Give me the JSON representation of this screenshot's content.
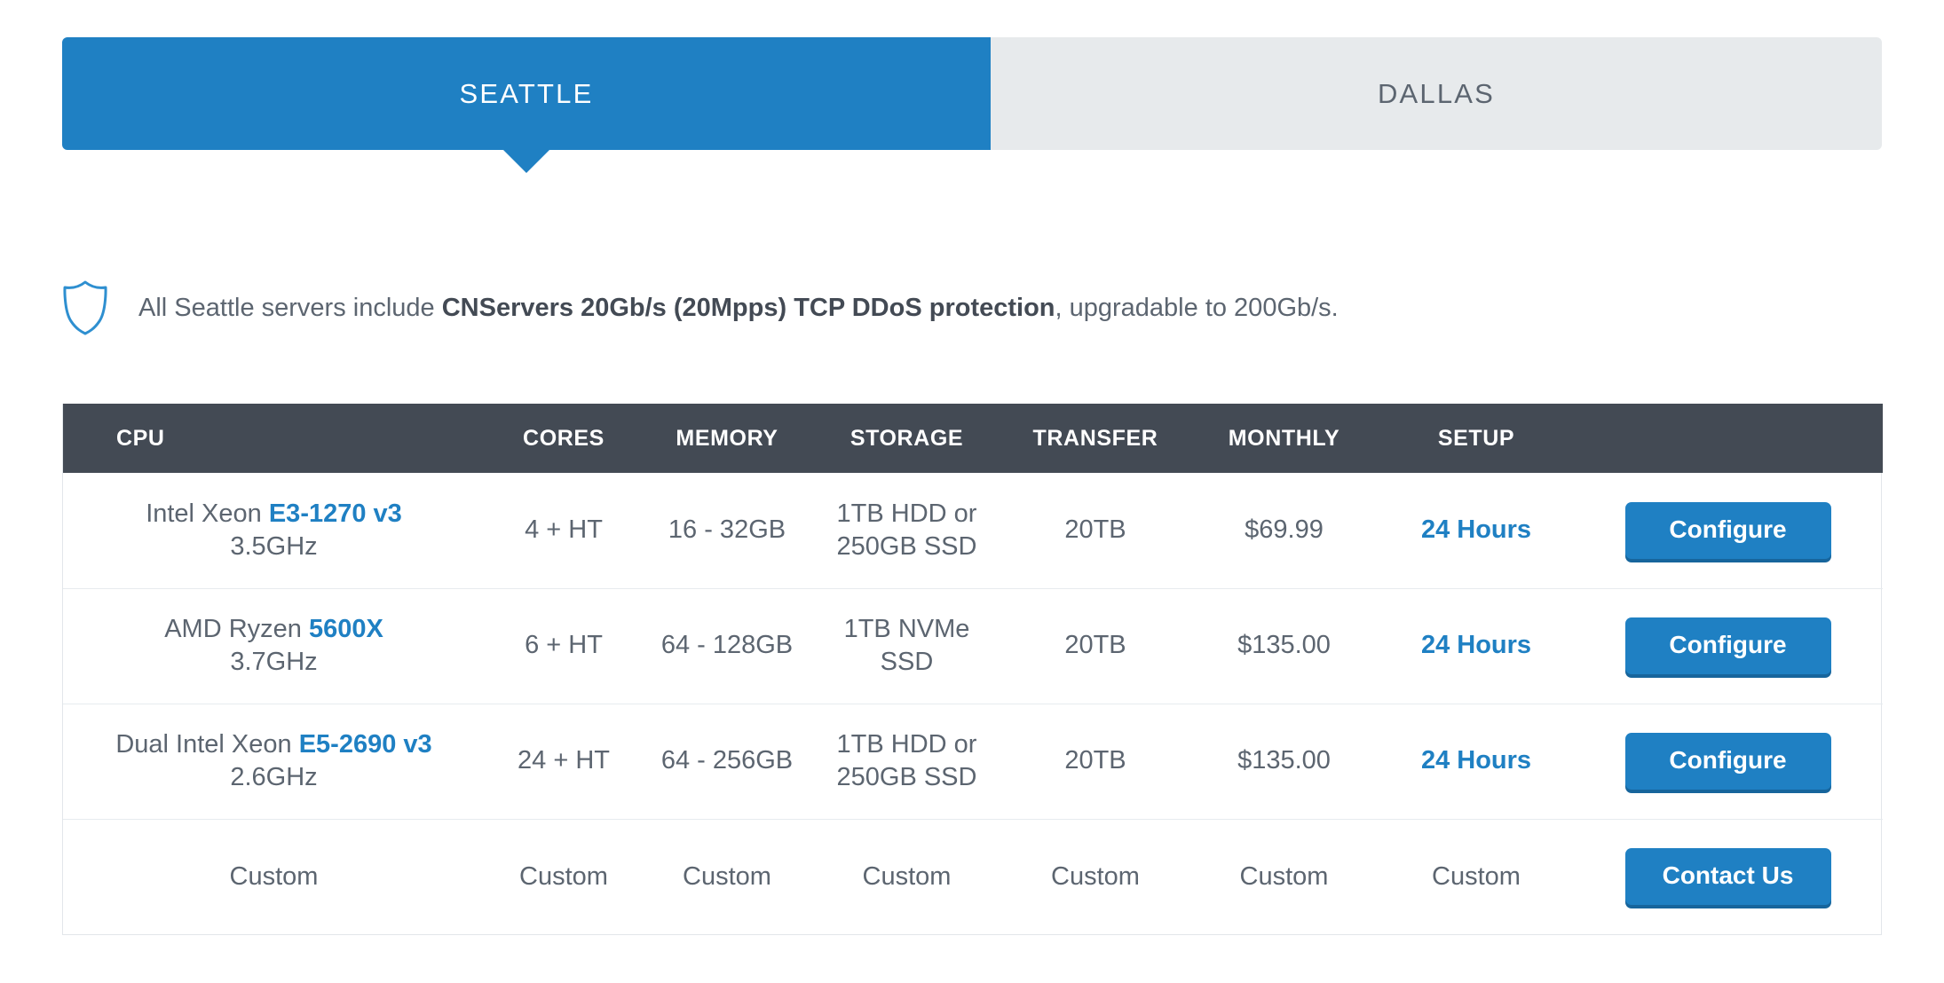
{
  "tabs": [
    {
      "label": "SEATTLE",
      "active": true
    },
    {
      "label": "DALLAS",
      "active": false
    }
  ],
  "notice": {
    "icon": "shield-icon",
    "prefix": "All Seattle servers include ",
    "bold": "CNServers 20Gb/s (20Mpps) TCP DDoS protection",
    "suffix": ", upgradable to 200Gb/s."
  },
  "table": {
    "headers": {
      "cpu": "CPU",
      "cores": "CORES",
      "memory": "MEMORY",
      "storage": "STORAGE",
      "transfer": "TRANSFER",
      "monthly": "MONTHLY",
      "setup": "SETUP",
      "action": ""
    },
    "rows": [
      {
        "cpu_brand": "Intel Xeon ",
        "cpu_model": "E3-1270 v3",
        "cpu_speed": "3.5GHz",
        "cores": "4 + HT",
        "memory": "16 - 32GB",
        "storage": "1TB HDD or 250GB SSD",
        "transfer": "20TB",
        "monthly": "$69.99",
        "setup": "24 Hours",
        "action": "Configure"
      },
      {
        "cpu_brand": "AMD Ryzen ",
        "cpu_model": "5600X",
        "cpu_speed": "3.7GHz",
        "cores": "6 + HT",
        "memory": "64 - 128GB",
        "storage": "1TB NVMe SSD",
        "transfer": "20TB",
        "monthly": "$135.00",
        "setup": "24 Hours",
        "action": "Configure"
      },
      {
        "cpu_brand": "Dual Intel Xeon ",
        "cpu_model": "E5-2690 v3",
        "cpu_speed": "2.6GHz",
        "cores": "24 + HT",
        "memory": "64 - 256GB",
        "storage": "1TB HDD or 250GB SSD",
        "transfer": "20TB",
        "monthly": "$135.00",
        "setup": "24 Hours",
        "action": "Configure"
      },
      {
        "cpu_brand": "",
        "cpu_model": "",
        "cpu_speed": "Custom",
        "cores": "Custom",
        "memory": "Custom",
        "storage": "Custom",
        "transfer": "Custom",
        "monthly": "Custom",
        "setup": "Custom",
        "action": "Contact Us"
      }
    ]
  },
  "colors": {
    "accent": "#1f80c3",
    "accent_shadow": "#17659c",
    "header_bg": "#434a54",
    "tab_inactive_bg": "#e7eaec",
    "text": "#5c6570",
    "border": "#e7ebef"
  }
}
